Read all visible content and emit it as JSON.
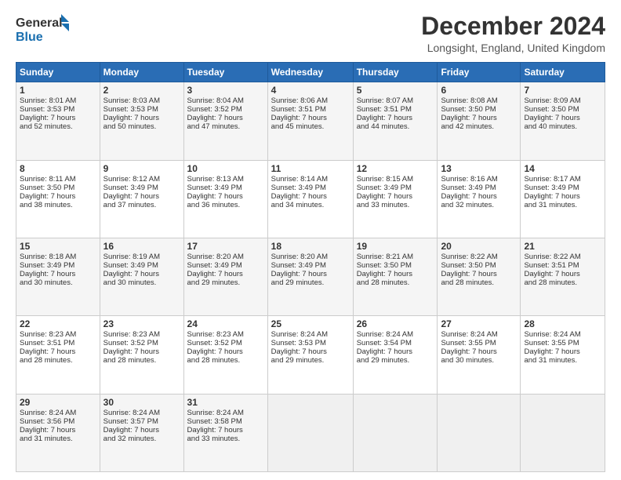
{
  "header": {
    "logo_general": "General",
    "logo_blue": "Blue",
    "title": "December 2024",
    "location": "Longsight, England, United Kingdom"
  },
  "days_of_week": [
    "Sunday",
    "Monday",
    "Tuesday",
    "Wednesday",
    "Thursday",
    "Friday",
    "Saturday"
  ],
  "weeks": [
    [
      {
        "day": "1",
        "lines": [
          "Sunrise: 8:01 AM",
          "Sunset: 3:53 PM",
          "Daylight: 7 hours",
          "and 52 minutes."
        ]
      },
      {
        "day": "2",
        "lines": [
          "Sunrise: 8:03 AM",
          "Sunset: 3:53 PM",
          "Daylight: 7 hours",
          "and 50 minutes."
        ]
      },
      {
        "day": "3",
        "lines": [
          "Sunrise: 8:04 AM",
          "Sunset: 3:52 PM",
          "Daylight: 7 hours",
          "and 47 minutes."
        ]
      },
      {
        "day": "4",
        "lines": [
          "Sunrise: 8:06 AM",
          "Sunset: 3:51 PM",
          "Daylight: 7 hours",
          "and 45 minutes."
        ]
      },
      {
        "day": "5",
        "lines": [
          "Sunrise: 8:07 AM",
          "Sunset: 3:51 PM",
          "Daylight: 7 hours",
          "and 44 minutes."
        ]
      },
      {
        "day": "6",
        "lines": [
          "Sunrise: 8:08 AM",
          "Sunset: 3:50 PM",
          "Daylight: 7 hours",
          "and 42 minutes."
        ]
      },
      {
        "day": "7",
        "lines": [
          "Sunrise: 8:09 AM",
          "Sunset: 3:50 PM",
          "Daylight: 7 hours",
          "and 40 minutes."
        ]
      }
    ],
    [
      {
        "day": "8",
        "lines": [
          "Sunrise: 8:11 AM",
          "Sunset: 3:50 PM",
          "Daylight: 7 hours",
          "and 38 minutes."
        ]
      },
      {
        "day": "9",
        "lines": [
          "Sunrise: 8:12 AM",
          "Sunset: 3:49 PM",
          "Daylight: 7 hours",
          "and 37 minutes."
        ]
      },
      {
        "day": "10",
        "lines": [
          "Sunrise: 8:13 AM",
          "Sunset: 3:49 PM",
          "Daylight: 7 hours",
          "and 36 minutes."
        ]
      },
      {
        "day": "11",
        "lines": [
          "Sunrise: 8:14 AM",
          "Sunset: 3:49 PM",
          "Daylight: 7 hours",
          "and 34 minutes."
        ]
      },
      {
        "day": "12",
        "lines": [
          "Sunrise: 8:15 AM",
          "Sunset: 3:49 PM",
          "Daylight: 7 hours",
          "and 33 minutes."
        ]
      },
      {
        "day": "13",
        "lines": [
          "Sunrise: 8:16 AM",
          "Sunset: 3:49 PM",
          "Daylight: 7 hours",
          "and 32 minutes."
        ]
      },
      {
        "day": "14",
        "lines": [
          "Sunrise: 8:17 AM",
          "Sunset: 3:49 PM",
          "Daylight: 7 hours",
          "and 31 minutes."
        ]
      }
    ],
    [
      {
        "day": "15",
        "lines": [
          "Sunrise: 8:18 AM",
          "Sunset: 3:49 PM",
          "Daylight: 7 hours",
          "and 30 minutes."
        ]
      },
      {
        "day": "16",
        "lines": [
          "Sunrise: 8:19 AM",
          "Sunset: 3:49 PM",
          "Daylight: 7 hours",
          "and 30 minutes."
        ]
      },
      {
        "day": "17",
        "lines": [
          "Sunrise: 8:20 AM",
          "Sunset: 3:49 PM",
          "Daylight: 7 hours",
          "and 29 minutes."
        ]
      },
      {
        "day": "18",
        "lines": [
          "Sunrise: 8:20 AM",
          "Sunset: 3:49 PM",
          "Daylight: 7 hours",
          "and 29 minutes."
        ]
      },
      {
        "day": "19",
        "lines": [
          "Sunrise: 8:21 AM",
          "Sunset: 3:50 PM",
          "Daylight: 7 hours",
          "and 28 minutes."
        ]
      },
      {
        "day": "20",
        "lines": [
          "Sunrise: 8:22 AM",
          "Sunset: 3:50 PM",
          "Daylight: 7 hours",
          "and 28 minutes."
        ]
      },
      {
        "day": "21",
        "lines": [
          "Sunrise: 8:22 AM",
          "Sunset: 3:51 PM",
          "Daylight: 7 hours",
          "and 28 minutes."
        ]
      }
    ],
    [
      {
        "day": "22",
        "lines": [
          "Sunrise: 8:23 AM",
          "Sunset: 3:51 PM",
          "Daylight: 7 hours",
          "and 28 minutes."
        ]
      },
      {
        "day": "23",
        "lines": [
          "Sunrise: 8:23 AM",
          "Sunset: 3:52 PM",
          "Daylight: 7 hours",
          "and 28 minutes."
        ]
      },
      {
        "day": "24",
        "lines": [
          "Sunrise: 8:23 AM",
          "Sunset: 3:52 PM",
          "Daylight: 7 hours",
          "and 28 minutes."
        ]
      },
      {
        "day": "25",
        "lines": [
          "Sunrise: 8:24 AM",
          "Sunset: 3:53 PM",
          "Daylight: 7 hours",
          "and 29 minutes."
        ]
      },
      {
        "day": "26",
        "lines": [
          "Sunrise: 8:24 AM",
          "Sunset: 3:54 PM",
          "Daylight: 7 hours",
          "and 29 minutes."
        ]
      },
      {
        "day": "27",
        "lines": [
          "Sunrise: 8:24 AM",
          "Sunset: 3:55 PM",
          "Daylight: 7 hours",
          "and 30 minutes."
        ]
      },
      {
        "day": "28",
        "lines": [
          "Sunrise: 8:24 AM",
          "Sunset: 3:55 PM",
          "Daylight: 7 hours",
          "and 31 minutes."
        ]
      }
    ],
    [
      {
        "day": "29",
        "lines": [
          "Sunrise: 8:24 AM",
          "Sunset: 3:56 PM",
          "Daylight: 7 hours",
          "and 31 minutes."
        ]
      },
      {
        "day": "30",
        "lines": [
          "Sunrise: 8:24 AM",
          "Sunset: 3:57 PM",
          "Daylight: 7 hours",
          "and 32 minutes."
        ]
      },
      {
        "day": "31",
        "lines": [
          "Sunrise: 8:24 AM",
          "Sunset: 3:58 PM",
          "Daylight: 7 hours",
          "and 33 minutes."
        ]
      },
      null,
      null,
      null,
      null
    ]
  ]
}
